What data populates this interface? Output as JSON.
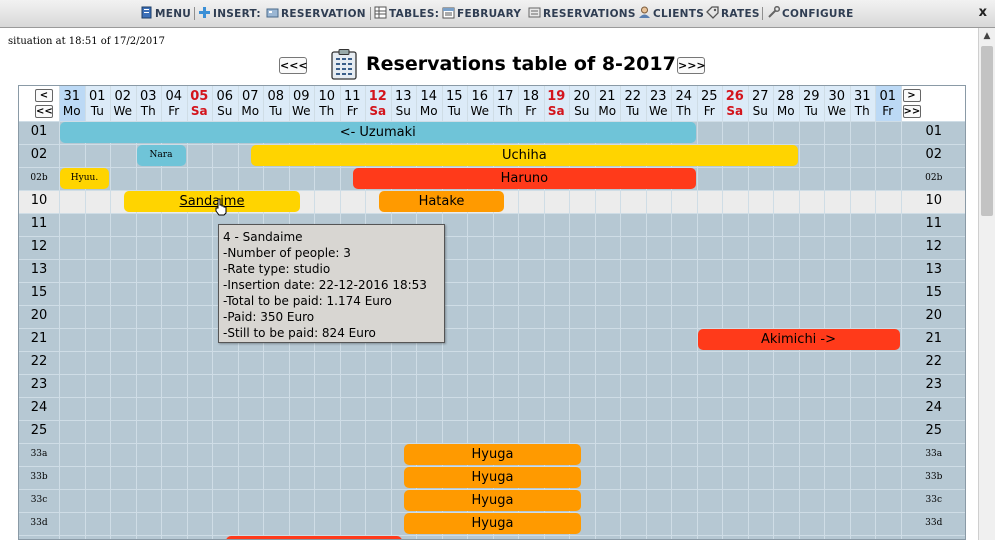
{
  "menu": {
    "items": [
      {
        "label": "MENU",
        "icon": "menu-doc-icon"
      },
      {
        "label": "INSERT:",
        "icon": "plus-icon"
      },
      {
        "label": "RESERVATION",
        "icon": "reservation-icon"
      },
      {
        "label": "TABLES:",
        "icon": "table-icon"
      },
      {
        "label": "FEBRUARY",
        "icon": "calendar-icon"
      },
      {
        "label": "RESERVATIONS",
        "icon": "reservations-icon"
      },
      {
        "label": "CLIENTS",
        "icon": "clients-icon"
      },
      {
        "label": "RATES",
        "icon": "tag-icon"
      },
      {
        "label": "CONFIGURE",
        "icon": "wrench-icon"
      }
    ],
    "close": "x"
  },
  "situation": "situation at 18:51 of 17/2/2017",
  "title": {
    "prev": "<<<",
    "next": ">>>",
    "text": "Reservations table of 8-2017."
  },
  "table": {
    "nav": {
      "prev": "<",
      "prev_fast": "<<",
      "next": ">",
      "next_fast": ">>"
    },
    "days": [
      {
        "n": "31",
        "w": "Mo",
        "hl": true,
        "sat": false
      },
      {
        "n": "01",
        "w": "Tu",
        "hl": false,
        "sat": false
      },
      {
        "n": "02",
        "w": "We",
        "hl": false,
        "sat": false
      },
      {
        "n": "03",
        "w": "Th",
        "hl": false,
        "sat": false
      },
      {
        "n": "04",
        "w": "Fr",
        "hl": false,
        "sat": false
      },
      {
        "n": "05",
        "w": "Sa",
        "hl": false,
        "sat": true
      },
      {
        "n": "06",
        "w": "Su",
        "hl": false,
        "sat": false
      },
      {
        "n": "07",
        "w": "Mo",
        "hl": false,
        "sat": false
      },
      {
        "n": "08",
        "w": "Tu",
        "hl": false,
        "sat": false
      },
      {
        "n": "09",
        "w": "We",
        "hl": false,
        "sat": false
      },
      {
        "n": "10",
        "w": "Th",
        "hl": false,
        "sat": false
      },
      {
        "n": "11",
        "w": "Fr",
        "hl": false,
        "sat": false
      },
      {
        "n": "12",
        "w": "Sa",
        "hl": false,
        "sat": true
      },
      {
        "n": "13",
        "w": "Su",
        "hl": false,
        "sat": false
      },
      {
        "n": "14",
        "w": "Mo",
        "hl": false,
        "sat": false
      },
      {
        "n": "15",
        "w": "Tu",
        "hl": false,
        "sat": false
      },
      {
        "n": "16",
        "w": "We",
        "hl": false,
        "sat": false
      },
      {
        "n": "17",
        "w": "Th",
        "hl": false,
        "sat": false
      },
      {
        "n": "18",
        "w": "Fr",
        "hl": false,
        "sat": false
      },
      {
        "n": "19",
        "w": "Sa",
        "hl": false,
        "sat": true
      },
      {
        "n": "20",
        "w": "Su",
        "hl": false,
        "sat": false
      },
      {
        "n": "21",
        "w": "Mo",
        "hl": false,
        "sat": false
      },
      {
        "n": "22",
        "w": "Tu",
        "hl": false,
        "sat": false
      },
      {
        "n": "23",
        "w": "We",
        "hl": false,
        "sat": false
      },
      {
        "n": "24",
        "w": "Th",
        "hl": false,
        "sat": false
      },
      {
        "n": "25",
        "w": "Fr",
        "hl": false,
        "sat": false
      },
      {
        "n": "26",
        "w": "Sa",
        "hl": false,
        "sat": true
      },
      {
        "n": "27",
        "w": "Su",
        "hl": false,
        "sat": false
      },
      {
        "n": "28",
        "w": "Mo",
        "hl": false,
        "sat": false
      },
      {
        "n": "29",
        "w": "Tu",
        "hl": false,
        "sat": false
      },
      {
        "n": "30",
        "w": "We",
        "hl": false,
        "sat": false
      },
      {
        "n": "31",
        "w": "Th",
        "hl": false,
        "sat": false
      },
      {
        "n": "01",
        "w": "Fr",
        "hl": true,
        "sat": false
      }
    ],
    "rooms": [
      {
        "label": "01",
        "small": false
      },
      {
        "label": "02",
        "small": false
      },
      {
        "label": "02b",
        "small": true
      },
      {
        "label": "10",
        "small": false
      },
      {
        "label": "11",
        "small": false
      },
      {
        "label": "12",
        "small": false
      },
      {
        "label": "13",
        "small": false
      },
      {
        "label": "15",
        "small": false
      },
      {
        "label": "20",
        "small": false
      },
      {
        "label": "21",
        "small": false
      },
      {
        "label": "22",
        "small": false
      },
      {
        "label": "23",
        "small": false
      },
      {
        "label": "24",
        "small": false
      },
      {
        "label": "25",
        "small": false
      },
      {
        "label": "33a",
        "small": true
      },
      {
        "label": "33b",
        "small": true
      },
      {
        "label": "33c",
        "small": true
      },
      {
        "label": "33d",
        "small": true
      }
    ],
    "highlight_row": 3,
    "reservations": [
      {
        "name": "<- Uzumaki",
        "row": 0,
        "start": 0,
        "end": 25,
        "color": "#6fc4d8",
        "small": false
      },
      {
        "name": "Nara",
        "row": 1,
        "start": 3,
        "end": 5,
        "color": "#6fc4d8",
        "small": true
      },
      {
        "name": "Uchiha",
        "row": 1,
        "start": 7.5,
        "end": 29,
        "color": "#ffd400",
        "small": false
      },
      {
        "name": "Hyuu.",
        "row": 2,
        "start": 0,
        "end": 2,
        "color": "#ffd400",
        "small": true
      },
      {
        "name": "Haruno",
        "row": 2,
        "start": 11.5,
        "end": 25,
        "color": "#ff3a1a",
        "small": false
      },
      {
        "name": "Sandaime",
        "row": 3,
        "start": 2.5,
        "end": 9.5,
        "color": "#ffd400",
        "small": false,
        "underline": true
      },
      {
        "name": "Hatake",
        "row": 3,
        "start": 12.5,
        "end": 17.5,
        "color": "#ff9a00",
        "small": false
      },
      {
        "name": "Akimichi ->",
        "row": 9,
        "start": 25,
        "end": 33,
        "color": "#ff3a1a",
        "small": false
      },
      {
        "name": "Hyuga",
        "row": 14,
        "start": 13.5,
        "end": 20.5,
        "color": "#ff9a00",
        "small": false
      },
      {
        "name": "Hyuga",
        "row": 15,
        "start": 13.5,
        "end": 20.5,
        "color": "#ff9a00",
        "small": false
      },
      {
        "name": "Hyuga",
        "row": 16,
        "start": 13.5,
        "end": 20.5,
        "color": "#ff9a00",
        "small": false
      },
      {
        "name": "Hyuga",
        "row": 17,
        "start": 13.5,
        "end": 20.5,
        "color": "#ff9a00",
        "small": false
      },
      {
        "name": "",
        "row": 18,
        "start": 6.5,
        "end": 13.5,
        "color": "#ff3a1a",
        "small": false
      }
    ]
  },
  "tooltip": {
    "lines": [
      "4 - Sandaime",
      "-Number of people: 3",
      "-Rate type: studio",
      "-Insertion date: 22-12-2016 18:53",
      "-Total to be paid: 1.174 Euro",
      "-Paid: 350 Euro",
      "-Still to be paid: 824 Euro"
    ]
  }
}
